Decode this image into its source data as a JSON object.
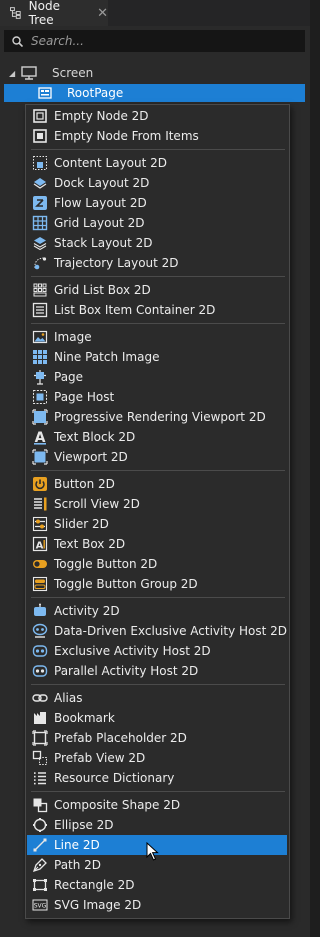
{
  "tab": {
    "title": "Node Tree",
    "close": "✕"
  },
  "search": {
    "placeholder": "Search..."
  },
  "tree": {
    "screen_label": "Screen",
    "root_label": "RootPage"
  },
  "menu": {
    "groups": [
      [
        {
          "label": "Empty Node 2D",
          "icon": "empty-node-icon"
        },
        {
          "label": "Empty Node From Items",
          "icon": "empty-node-items-icon"
        }
      ],
      [
        {
          "label": "Content Layout 2D",
          "icon": "content-layout-icon"
        },
        {
          "label": "Dock Layout 2D",
          "icon": "dock-layout-icon"
        },
        {
          "label": "Flow Layout 2D",
          "icon": "flow-layout-icon"
        },
        {
          "label": "Grid Layout 2D",
          "icon": "grid-layout-icon"
        },
        {
          "label": "Stack Layout 2D",
          "icon": "stack-layout-icon"
        },
        {
          "label": "Trajectory Layout 2D",
          "icon": "trajectory-layout-icon"
        }
      ],
      [
        {
          "label": "Grid List Box 2D",
          "icon": "grid-list-box-icon"
        },
        {
          "label": "List Box Item Container 2D",
          "icon": "list-box-item-container-icon"
        }
      ],
      [
        {
          "label": "Image",
          "icon": "image-icon"
        },
        {
          "label": "Nine Patch Image",
          "icon": "nine-patch-image-icon"
        },
        {
          "label": "Page",
          "icon": "page-icon"
        },
        {
          "label": "Page Host",
          "icon": "page-host-icon"
        },
        {
          "label": "Progressive Rendering Viewport 2D",
          "icon": "progressive-viewport-icon"
        },
        {
          "label": "Text Block 2D",
          "icon": "text-block-icon"
        },
        {
          "label": "Viewport 2D",
          "icon": "viewport-icon"
        }
      ],
      [
        {
          "label": "Button 2D",
          "icon": "button-icon"
        },
        {
          "label": "Scroll View 2D",
          "icon": "scroll-view-icon"
        },
        {
          "label": "Slider 2D",
          "icon": "slider-icon"
        },
        {
          "label": "Text Box 2D",
          "icon": "text-box-icon"
        },
        {
          "label": "Toggle Button 2D",
          "icon": "toggle-button-icon"
        },
        {
          "label": "Toggle Button Group 2D",
          "icon": "toggle-button-group-icon"
        }
      ],
      [
        {
          "label": "Activity 2D",
          "icon": "activity-icon"
        },
        {
          "label": "Data-Driven Exclusive Activity Host 2D",
          "icon": "data-driven-activity-host-icon"
        },
        {
          "label": "Exclusive Activity Host 2D",
          "icon": "exclusive-activity-host-icon"
        },
        {
          "label": "Parallel Activity Host 2D",
          "icon": "parallel-activity-host-icon"
        }
      ],
      [
        {
          "label": "Alias",
          "icon": "alias-icon"
        },
        {
          "label": "Bookmark",
          "icon": "bookmark-icon"
        },
        {
          "label": "Prefab Placeholder 2D",
          "icon": "prefab-placeholder-icon"
        },
        {
          "label": "Prefab View 2D",
          "icon": "prefab-view-icon"
        },
        {
          "label": "Resource Dictionary",
          "icon": "resource-dictionary-icon"
        }
      ],
      [
        {
          "label": "Composite Shape 2D",
          "icon": "composite-shape-icon"
        },
        {
          "label": "Ellipse 2D",
          "icon": "ellipse-icon"
        },
        {
          "label": "Line 2D",
          "icon": "line-icon",
          "highlighted": true
        },
        {
          "label": "Path 2D",
          "icon": "path-icon"
        },
        {
          "label": "Rectangle 2D",
          "icon": "rectangle-icon"
        },
        {
          "label": "SVG Image 2D",
          "icon": "svg-image-icon"
        }
      ]
    ]
  },
  "colors": {
    "accent": "#1d7fd4",
    "orange": "#e8a020",
    "icon": "#7db9f0"
  }
}
